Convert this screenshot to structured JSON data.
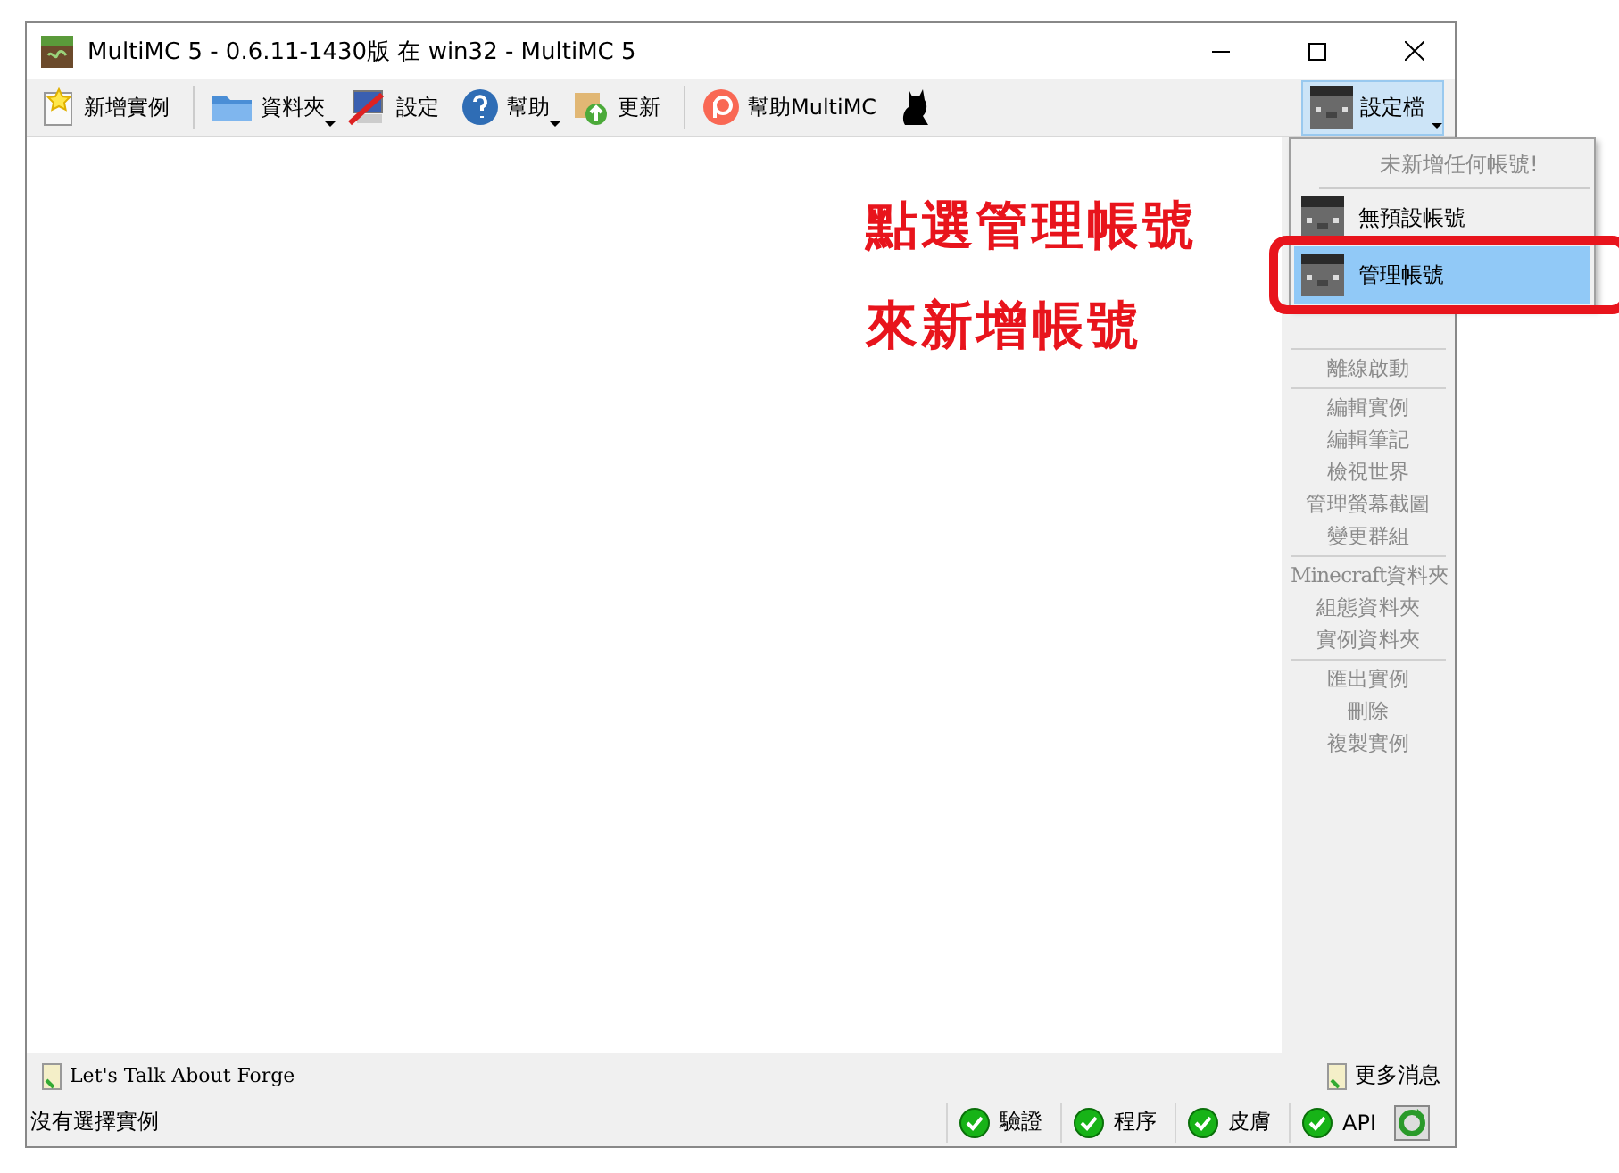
{
  "window": {
    "title": "MultiMC 5 - 0.6.11-1430版 在 win32 - MultiMC 5"
  },
  "toolbar": [
    {
      "label": "新增實例",
      "kind": "star",
      "has_menu": false
    },
    {
      "label": "資料夾",
      "kind": "folder",
      "has_menu": true
    },
    {
      "label": "設定",
      "kind": "settings",
      "has_menu": false
    },
    {
      "label": "幫助",
      "kind": "help",
      "has_menu": true
    },
    {
      "label": "更新",
      "kind": "update",
      "has_menu": false
    },
    {
      "label": "幫助MultiMC",
      "kind": "patreon",
      "has_menu": false
    },
    {
      "kind": "cat",
      "has_menu": false
    }
  ],
  "profile_button": {
    "label": "設定檔"
  },
  "profile_menu": [
    {
      "label": "未新增任何帳號!",
      "kind": "header",
      "selected": false,
      "circled": false
    },
    {
      "label": "無預設帳號",
      "kind": "account",
      "selected": false,
      "circled": false
    },
    {
      "label": "管理帳號",
      "kind": "account",
      "selected": true,
      "circled": true
    }
  ],
  "annotation": {
    "lines": [
      "點選管理帳號",
      "來新增帳號"
    ]
  },
  "instance_actions": [
    [
      {
        "label": "離線啟動",
        "disabled": true
      }
    ],
    [
      {
        "label": "編輯實例",
        "disabled": true
      },
      {
        "label": "編輯筆記",
        "disabled": true
      },
      {
        "label": "檢視世界",
        "disabled": true
      },
      {
        "label": "管理螢幕截圖",
        "disabled": true
      },
      {
        "label": "變更群組",
        "disabled": true
      }
    ],
    [
      {
        "label": "Minecraft資料夾",
        "disabled": true
      },
      {
        "label": "組態資料夾",
        "disabled": true
      },
      {
        "label": "實例資料夾",
        "disabled": true
      }
    ],
    [
      {
        "label": "匯出實例",
        "disabled": true
      },
      {
        "label": "刪除",
        "disabled": true
      },
      {
        "label": "複製實例",
        "disabled": true
      }
    ]
  ],
  "news_bar": {
    "headline": "Let's Talk About Forge",
    "more": "更多消息"
  },
  "status_bar": {
    "text": "沒有選擇實例",
    "services": [
      {
        "label": "驗證",
        "ok": true
      },
      {
        "label": "程序",
        "ok": true
      },
      {
        "label": "皮膚",
        "ok": true
      },
      {
        "label": "API",
        "ok": true
      }
    ]
  }
}
